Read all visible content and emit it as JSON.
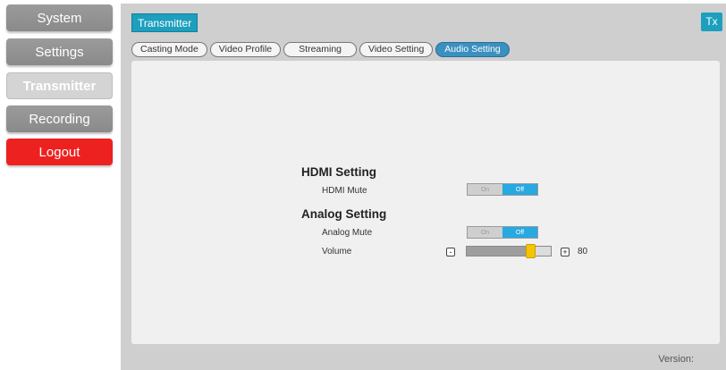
{
  "sidebar": {
    "items": [
      {
        "label": "System"
      },
      {
        "label": "Settings"
      },
      {
        "label": "Transmitter"
      },
      {
        "label": "Recording"
      },
      {
        "label": "Logout"
      }
    ]
  },
  "header": {
    "title": "Transmitter",
    "mode_badge": "Tx"
  },
  "tabs": [
    {
      "label": "Casting Mode"
    },
    {
      "label": "Video Profile"
    },
    {
      "label": "Streaming"
    },
    {
      "label": "Video Setting"
    },
    {
      "label": "Audio Setting"
    }
  ],
  "hdmi": {
    "section_title": "HDMI Setting",
    "mute_label": "HDMI Mute",
    "toggle_on": "On",
    "toggle_off": "Off"
  },
  "analog": {
    "section_title": "Analog Setting",
    "mute_label": "Analog Mute",
    "toggle_on": "On",
    "toggle_off": "Off",
    "volume_label": "Volume",
    "volume_minus": "-",
    "volume_plus": "+",
    "volume_value": "80"
  },
  "footer": {
    "version_label": "Version:"
  },
  "colors": {
    "accent": "#1d9fbe",
    "active_tab": "#3a90c0",
    "logout": "#ee2121",
    "toggle_active": "#27a9e1",
    "slider_thumb": "#f5c400"
  }
}
